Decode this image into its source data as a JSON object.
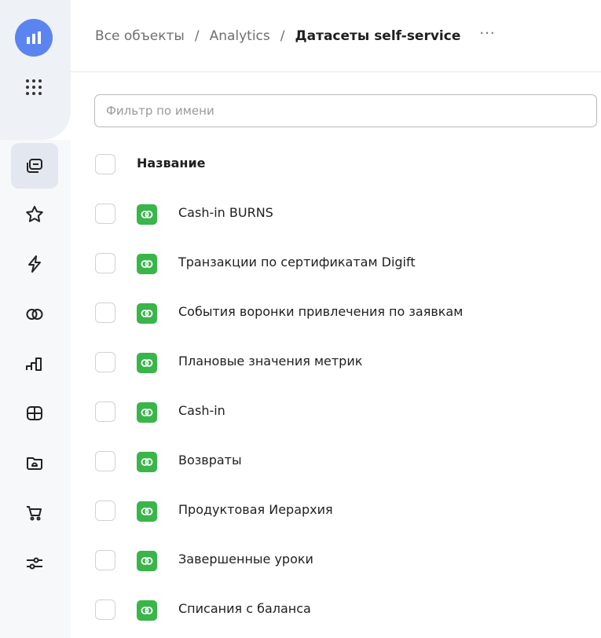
{
  "colors": {
    "brand": "#5b84f0",
    "dataset_icon": "#3ab54a",
    "sidebar_active": "#e2e7f0"
  },
  "sidebar": {
    "logo_icon": "bar-chart-icon",
    "apps_icon": "apps-grid-icon",
    "items": [
      {
        "icon": "collections-icon",
        "active": true
      },
      {
        "icon": "star-icon",
        "active": false
      },
      {
        "icon": "lightning-icon",
        "active": false
      },
      {
        "icon": "datasets-icon",
        "active": false
      },
      {
        "icon": "charts-icon",
        "active": false
      },
      {
        "icon": "dashboard-icon",
        "active": false
      },
      {
        "icon": "folder-icon",
        "active": false
      },
      {
        "icon": "cart-icon",
        "active": false
      },
      {
        "icon": "settings-sliders-icon",
        "active": false
      }
    ]
  },
  "header": {
    "breadcrumb": [
      "Все объекты",
      "Analytics"
    ],
    "separator": "/",
    "current": "Датасеты self-service",
    "more": "···"
  },
  "filter": {
    "placeholder": "Фильтр по имени",
    "value": ""
  },
  "table": {
    "column_header": "Название",
    "rows": [
      "Cash-in BURNS",
      "Транзакции по сертификатам Digift",
      "События воронки привлечения по заявкам",
      "Плановые значения метрик",
      "Cash-in",
      "Возвраты",
      "Продуктовая Иерархия",
      "Завершенные уроки",
      "Списания с баланса"
    ]
  }
}
